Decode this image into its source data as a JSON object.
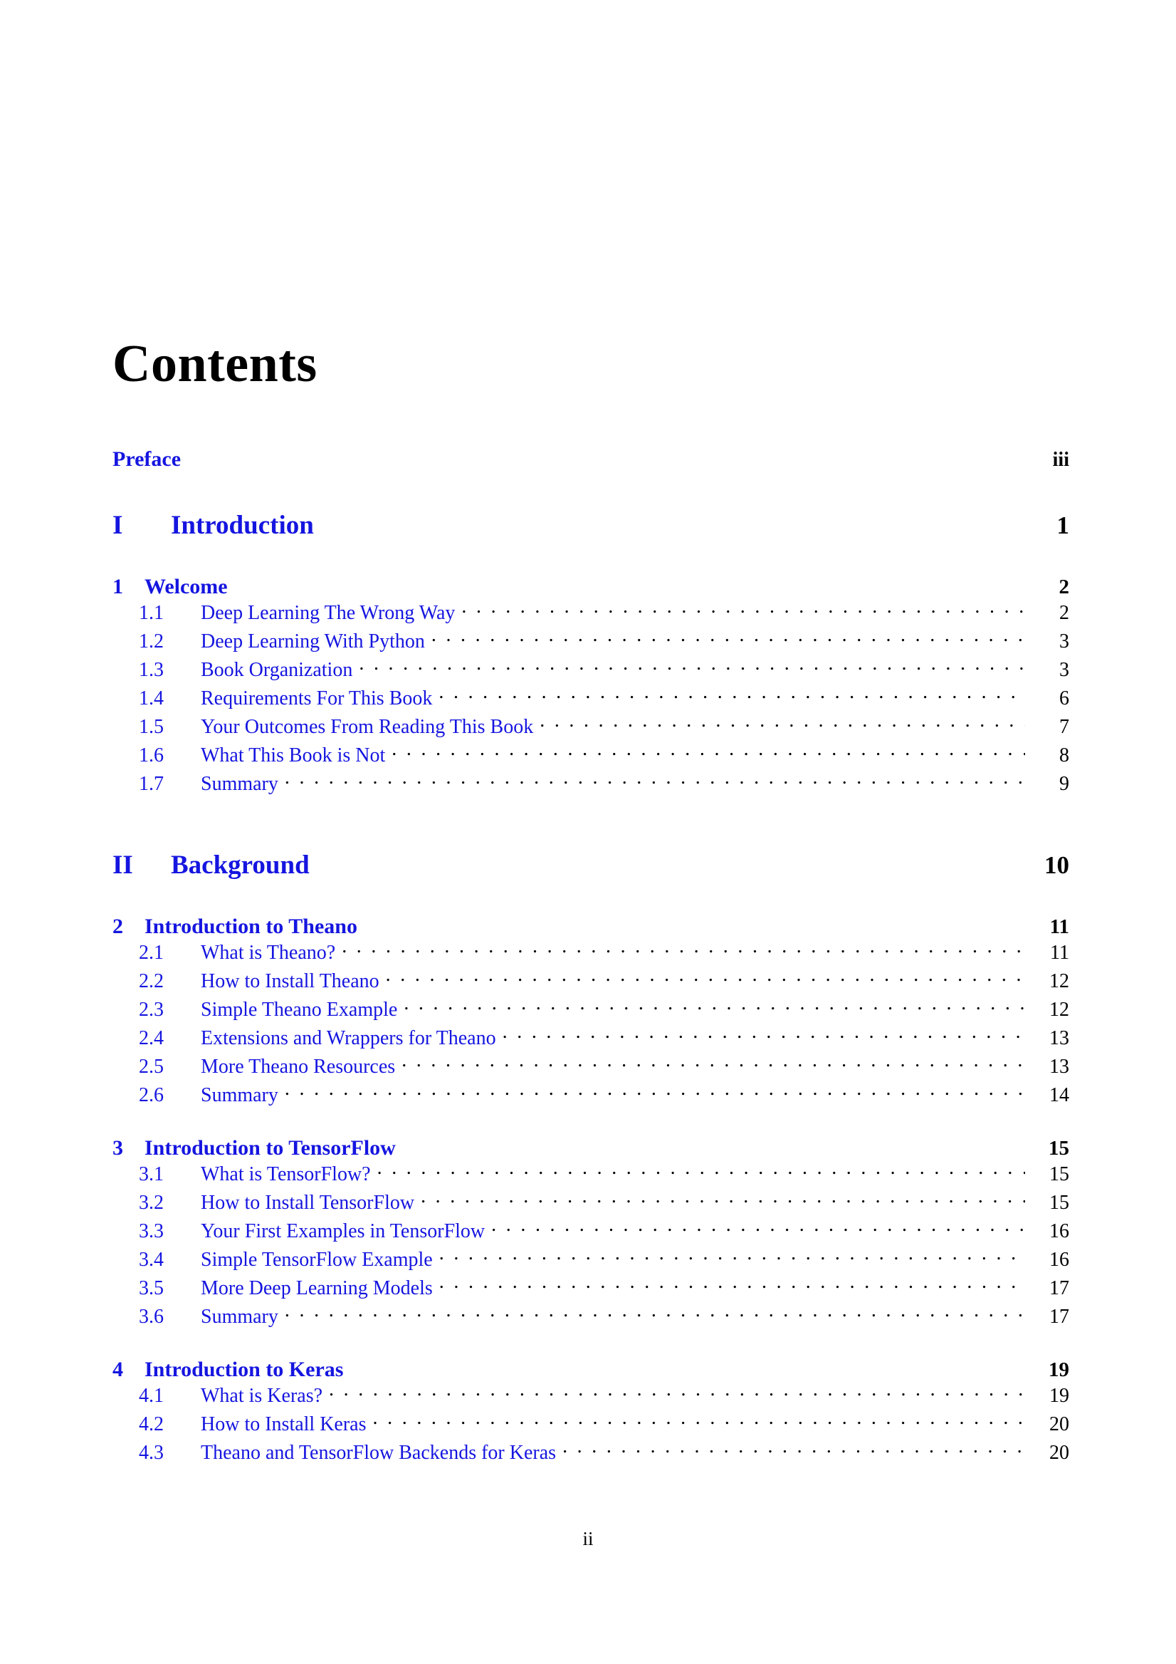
{
  "document": {
    "title": "Contents",
    "footer_page_number": "ii",
    "link_color": "#1515e0",
    "text_color": "#000000"
  },
  "frontmatter": [
    {
      "label": "Preface",
      "page": "iii"
    }
  ],
  "parts": [
    {
      "number": "I",
      "title": "Introduction",
      "page": "1",
      "chapters": [
        {
          "number": "1",
          "title": "Welcome",
          "page": "2",
          "sections": [
            {
              "number": "1.1",
              "title": "Deep Learning The Wrong Way",
              "page": "2"
            },
            {
              "number": "1.2",
              "title": "Deep Learning With Python",
              "page": "3"
            },
            {
              "number": "1.3",
              "title": "Book Organization",
              "page": "3"
            },
            {
              "number": "1.4",
              "title": "Requirements For This Book",
              "page": "6"
            },
            {
              "number": "1.5",
              "title": "Your Outcomes From Reading This Book",
              "page": "7"
            },
            {
              "number": "1.6",
              "title": "What This Book is Not",
              "page": "8"
            },
            {
              "number": "1.7",
              "title": "Summary",
              "page": "9"
            }
          ]
        }
      ]
    },
    {
      "number": "II",
      "title": "Background",
      "page": "10",
      "chapters": [
        {
          "number": "2",
          "title": "Introduction to Theano",
          "page": "11",
          "sections": [
            {
              "number": "2.1",
              "title": "What is Theano?",
              "page": "11"
            },
            {
              "number": "2.2",
              "title": "How to Install Theano",
              "page": "12"
            },
            {
              "number": "2.3",
              "title": "Simple Theano Example",
              "page": "12"
            },
            {
              "number": "2.4",
              "title": "Extensions and Wrappers for Theano",
              "page": "13"
            },
            {
              "number": "2.5",
              "title": "More Theano Resources",
              "page": "13"
            },
            {
              "number": "2.6",
              "title": "Summary",
              "page": "14"
            }
          ]
        },
        {
          "number": "3",
          "title": "Introduction to TensorFlow",
          "page": "15",
          "sections": [
            {
              "number": "3.1",
              "title": "What is TensorFlow?",
              "page": "15"
            },
            {
              "number": "3.2",
              "title": "How to Install TensorFlow",
              "page": "15"
            },
            {
              "number": "3.3",
              "title": "Your First Examples in TensorFlow",
              "page": "16"
            },
            {
              "number": "3.4",
              "title": "Simple TensorFlow Example",
              "page": "16"
            },
            {
              "number": "3.5",
              "title": "More Deep Learning Models",
              "page": "17"
            },
            {
              "number": "3.6",
              "title": "Summary",
              "page": "17"
            }
          ]
        },
        {
          "number": "4",
          "title": "Introduction to Keras",
          "page": "19",
          "sections": [
            {
              "number": "4.1",
              "title": "What is Keras?",
              "page": "19"
            },
            {
              "number": "4.2",
              "title": "How to Install Keras",
              "page": "20"
            },
            {
              "number": "4.3",
              "title": "Theano and TensorFlow Backends for Keras",
              "page": "20"
            }
          ]
        }
      ]
    }
  ]
}
